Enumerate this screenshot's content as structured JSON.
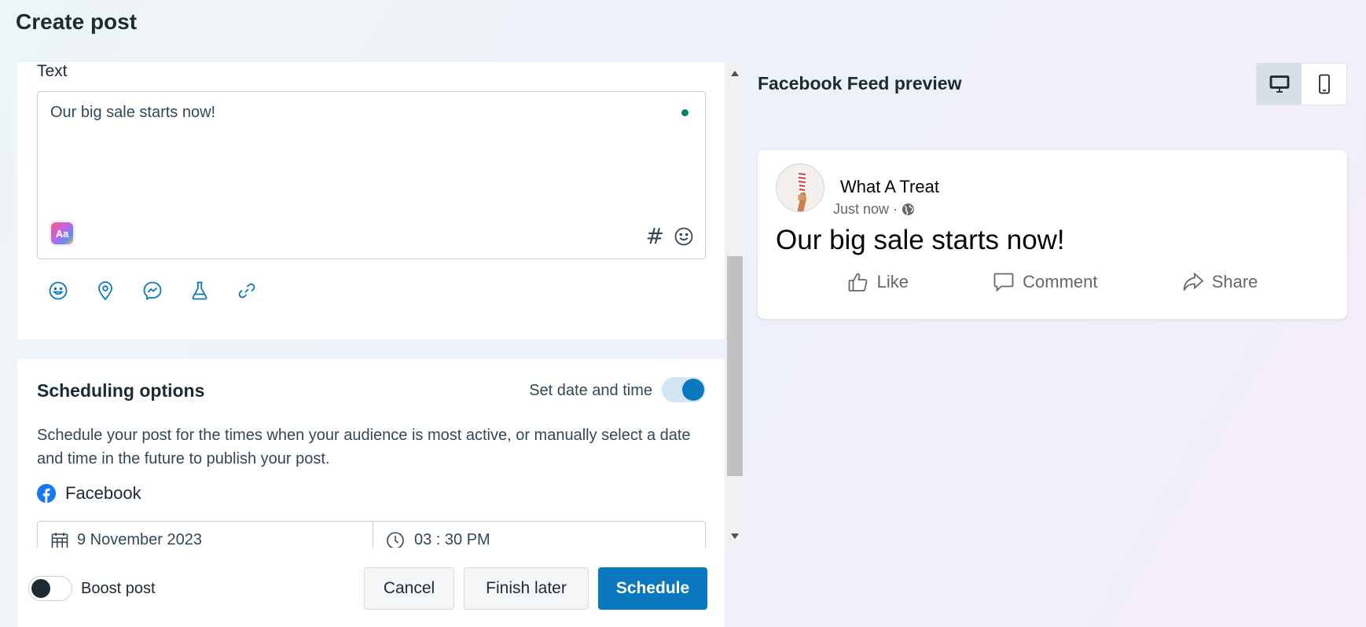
{
  "page": {
    "title": "Create post"
  },
  "text_section": {
    "label": "Text",
    "value": "Our big sale starts now!",
    "aa_badge": "Aa",
    "hashtag_glyph": "#",
    "icons": [
      "emoji-icon",
      "location-pin-icon",
      "messenger-icon",
      "flask-icon",
      "link-icon"
    ]
  },
  "scheduling": {
    "title": "Scheduling options",
    "toggle_label": "Set date and time",
    "toggle_on": true,
    "description": "Schedule your post for the times when your audience is most active, or manually select a date and time in the future to publish your post.",
    "platform": "Facebook",
    "date": "9 November 2023",
    "time": "03 : 30 PM"
  },
  "footer": {
    "boost_label": "Boost post",
    "boost_on": false,
    "cancel": "Cancel",
    "finish_later": "Finish later",
    "schedule": "Schedule"
  },
  "preview": {
    "title": "Facebook Feed preview",
    "page_name": "What A Treat",
    "time": "Just now ·",
    "post_text": "Our big sale starts now!",
    "actions": {
      "like": "Like",
      "comment": "Comment",
      "share": "Share"
    }
  },
  "colors": {
    "accent": "#0a78be",
    "facebook_blue": "#1877f2",
    "text_dark": "#1c2b33",
    "status_green": "#07806b"
  }
}
